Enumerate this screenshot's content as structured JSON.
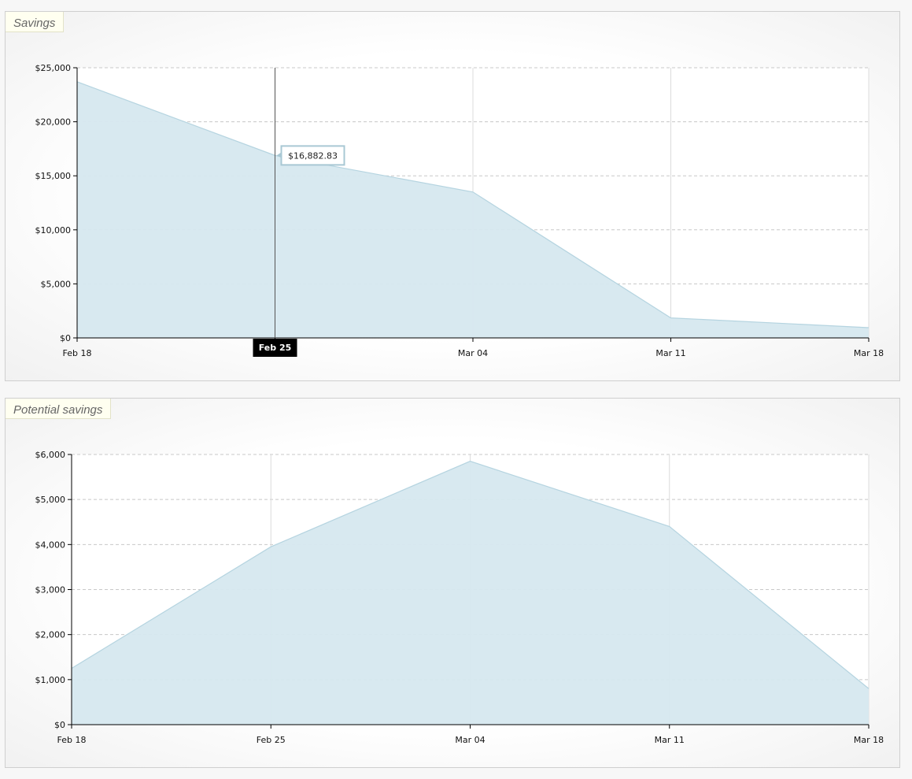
{
  "panels": [
    {
      "title": "Savings"
    },
    {
      "title": "Potential savings"
    }
  ],
  "chart_data": [
    {
      "type": "area",
      "title": "Savings",
      "x": [
        "Feb 18",
        "Feb 25",
        "Mar 04",
        "Mar 11",
        "Mar 18"
      ],
      "series": [
        {
          "values": [
            23700,
            16882.83,
            13500,
            1850,
            950
          ]
        }
      ],
      "ylim": [
        0,
        25000
      ],
      "yticks": [
        "$0",
        "$5,000",
        "$10,000",
        "$15,000",
        "$20,000",
        "$25,000"
      ],
      "ytick_values": [
        0,
        5000,
        10000,
        15000,
        20000,
        25000
      ],
      "grid": true,
      "fill_color": "#d6e8ef",
      "line_color": "#b5d4e0",
      "hover": {
        "index": 1,
        "label": "Feb 25",
        "value_text": "$16,882.83"
      }
    },
    {
      "type": "area",
      "title": "Potential savings",
      "x": [
        "Feb 18",
        "Feb 25",
        "Mar 04",
        "Mar 11",
        "Mar 18"
      ],
      "series": [
        {
          "values": [
            1250,
            3950,
            5850,
            4400,
            800
          ]
        }
      ],
      "ylim": [
        0,
        6000
      ],
      "yticks": [
        "$0",
        "$1,000",
        "$2,000",
        "$3,000",
        "$4,000",
        "$5,000",
        "$6,000"
      ],
      "ytick_values": [
        0,
        1000,
        2000,
        3000,
        4000,
        5000,
        6000
      ],
      "grid": true,
      "fill_color": "#d6e8ef",
      "line_color": "#b5d4e0"
    }
  ]
}
